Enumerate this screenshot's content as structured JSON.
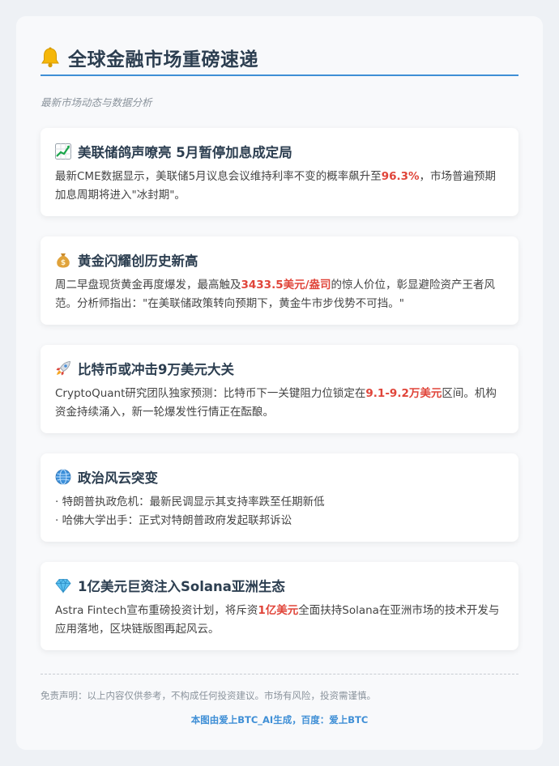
{
  "header": {
    "title": "全球金融市场重磅速递",
    "icon": "bell-icon",
    "subtitle": "最新市场动态与数据分析",
    "accent": "#3f8fd6"
  },
  "cards": [
    {
      "icon": "chart-up-icon",
      "title": "美联储鸽声嘹亮 5月暂停加息成定局",
      "body_before": "最新CME数据显示，美联储5月议息会议维持利率不变的概率飙升至",
      "highlight": "96.3%",
      "body_after": "，市场普遍预期加息周期将进入\"冰封期\"。"
    },
    {
      "icon": "money-bag-icon",
      "title": "黄金闪耀创历史新高",
      "body_before": "周二早盘现货黄金再度爆发，最高触及",
      "highlight": "3433.5美元/盎司",
      "body_after": "的惊人价位，彰显避险资产王者风范。分析师指出：\"在美联储政策转向预期下，黄金牛市步伐势不可挡。\""
    },
    {
      "icon": "rocket-icon",
      "title": "比特币或冲击9万美元大关",
      "body_before": "CryptoQuant研究团队独家预测：比特币下一关键阻力位锁定在",
      "highlight": "9.1-9.2万美元",
      "body_after": "区间。机构资金持续涌入，新一轮爆发性行情正在酝酿。"
    },
    {
      "icon": "globe-icon",
      "title": "政治风云突变",
      "bullets": [
        "· 特朗普执政危机：最新民调显示其支持率跌至任期新低",
        "· 哈佛大学出手：正式对特朗普政府发起联邦诉讼"
      ]
    },
    {
      "icon": "gem-icon",
      "title": "1亿美元巨资注入Solana亚洲生态",
      "body_before": "Astra Fintech宣布重磅投资计划，将斥资",
      "highlight": "1亿美元",
      "body_after": "全面扶持Solana在亚洲市场的技术开发与应用落地，区块链版图再起风云。"
    }
  ],
  "footer": {
    "disclaimer": "免责声明：以上内容仅供参考，不构成任何投资建议。市场有风险，投资需谨慎。",
    "credit": "本图由爱上BTC_AI生成，百度：爱上BTC"
  },
  "colors": {
    "highlight": "#e0453a",
    "title_text": "#2c3e50",
    "muted": "#8a939c"
  }
}
